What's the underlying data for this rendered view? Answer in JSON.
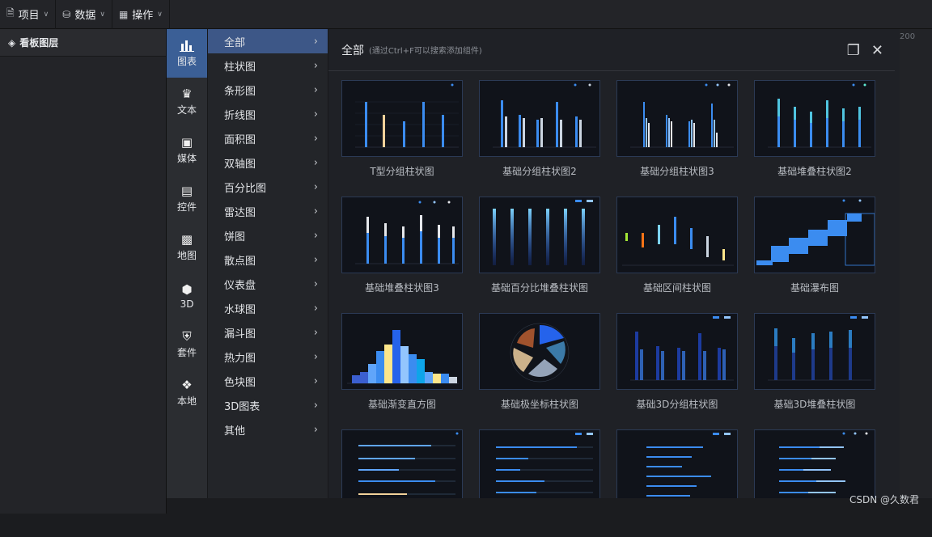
{
  "topbar": {
    "menus": [
      {
        "label": "项目",
        "icon": "document-icon"
      },
      {
        "label": "数据",
        "icon": "database-icon"
      },
      {
        "label": "操作",
        "icon": "grid-icon"
      }
    ]
  },
  "layers": {
    "title": "看板图层"
  },
  "categories": [
    {
      "label": "图表",
      "icon": "bar-chart-icon",
      "active": true
    },
    {
      "label": "文本",
      "icon": "crown-icon"
    },
    {
      "label": "媒体",
      "icon": "media-icon"
    },
    {
      "label": "控件",
      "icon": "controls-icon"
    },
    {
      "label": "地图",
      "icon": "map-icon"
    },
    {
      "label": "3D",
      "icon": "cube-icon"
    },
    {
      "label": "套件",
      "icon": "shirt-icon"
    },
    {
      "label": "本地",
      "icon": "puzzle-icon"
    }
  ],
  "subcategories": [
    "全部",
    "柱状图",
    "条形图",
    "折线图",
    "面积图",
    "双轴图",
    "百分比图",
    "雷达图",
    "饼图",
    "散点图",
    "仪表盘",
    "水球图",
    "漏斗图",
    "热力图",
    "色块图",
    "3D图表",
    "其他"
  ],
  "panel": {
    "title": "全部",
    "hint": "(通过Ctrl+F可以搜索添加组件)"
  },
  "cards": [
    {
      "label": "T型分组柱状图"
    },
    {
      "label": "基础分组柱状图2"
    },
    {
      "label": "基础分组柱状图3"
    },
    {
      "label": "基础堆叠柱状图2"
    },
    {
      "label": "基础堆叠柱状图3"
    },
    {
      "label": "基础百分比堆叠柱状图"
    },
    {
      "label": "基础区间柱状图"
    },
    {
      "label": "基础瀑布图"
    },
    {
      "label": "基础渐变直方图"
    },
    {
      "label": "基础极坐标柱状图"
    },
    {
      "label": "基础3D分组柱状图"
    },
    {
      "label": "基础3D堆叠柱状图"
    },
    {
      "label": ""
    },
    {
      "label": ""
    },
    {
      "label": ""
    },
    {
      "label": ""
    }
  ],
  "ruler": {
    "label": "200"
  },
  "watermark": "CSDN @久数君",
  "colors": {
    "accent": "#3d5787",
    "bar_blue": "#3b8cf0",
    "bar_tan": "#f2d19a"
  }
}
